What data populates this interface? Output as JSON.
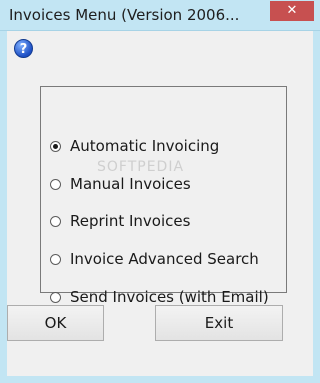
{
  "window": {
    "title": "Invoices Menu (Version 2006...",
    "close_glyph": "✕"
  },
  "help": {
    "icon": "help-icon",
    "glyph": "?"
  },
  "watermark": "SOFTPEDIA",
  "options": [
    {
      "label": "Automatic Invoicing",
      "checked": true
    },
    {
      "label": "Manual Invoices",
      "checked": false
    },
    {
      "label": "Reprint Invoices",
      "checked": false
    },
    {
      "label": "Invoice Advanced Search",
      "checked": false
    },
    {
      "label": "Send Invoices (with Email)",
      "checked": false
    }
  ],
  "buttons": {
    "ok_label": "OK",
    "exit_label": "Exit"
  },
  "colors": {
    "titlebar": "#c2e5f3",
    "close": "#c75050",
    "background": "#f0f0f0"
  }
}
